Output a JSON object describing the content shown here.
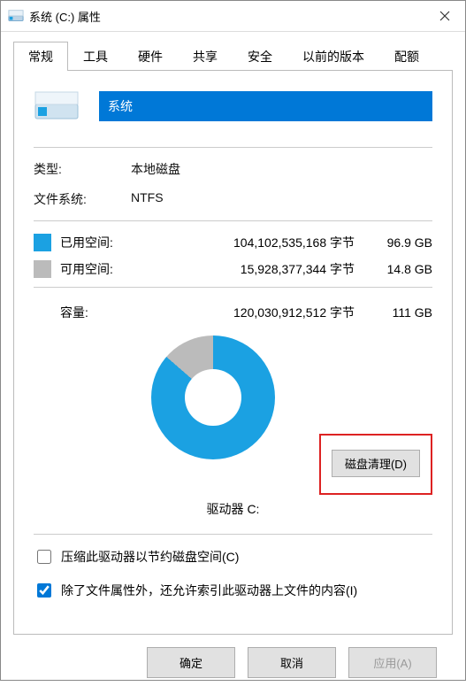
{
  "window": {
    "title": "系统 (C:) 属性"
  },
  "tabs": {
    "items": [
      {
        "label": "常规"
      },
      {
        "label": "工具"
      },
      {
        "label": "硬件"
      },
      {
        "label": "共享"
      },
      {
        "label": "安全"
      },
      {
        "label": "以前的版本"
      },
      {
        "label": "配额"
      }
    ],
    "active_index": 0
  },
  "general": {
    "drive_name_value": "系统",
    "type_label": "类型:",
    "type_value": "本地磁盘",
    "fs_label": "文件系统:",
    "fs_value": "NTFS",
    "used_label": "已用空间:",
    "used_bytes": "104,102,535,168 字节",
    "used_gb": "96.9 GB",
    "used_color": "#1ba1e2",
    "free_label": "可用空间:",
    "free_bytes": "15,928,377,344 字节",
    "free_gb": "14.8 GB",
    "free_color": "#bbbbbb",
    "capacity_label": "容量:",
    "capacity_bytes": "120,030,912,512 字节",
    "capacity_gb": "111 GB",
    "drive_label_below_chart": "驱动器 C:",
    "disk_cleanup_button": "磁盘清理(D)",
    "compress_label": "压缩此驱动器以节约磁盘空间(C)",
    "compress_checked": false,
    "index_label": "除了文件属性外，还允许索引此驱动器上文件的内容(I)",
    "index_checked": true
  },
  "chart_data": {
    "type": "pie",
    "title": "驱动器 C:",
    "series": [
      {
        "name": "已用空间",
        "value": 96.9,
        "unit": "GB",
        "color": "#1ba1e2"
      },
      {
        "name": "可用空间",
        "value": 14.8,
        "unit": "GB",
        "color": "#bbbbbb"
      }
    ],
    "total": {
      "value": 111,
      "unit": "GB"
    }
  },
  "footer": {
    "ok": "确定",
    "cancel": "取消",
    "apply": "应用(A)"
  }
}
